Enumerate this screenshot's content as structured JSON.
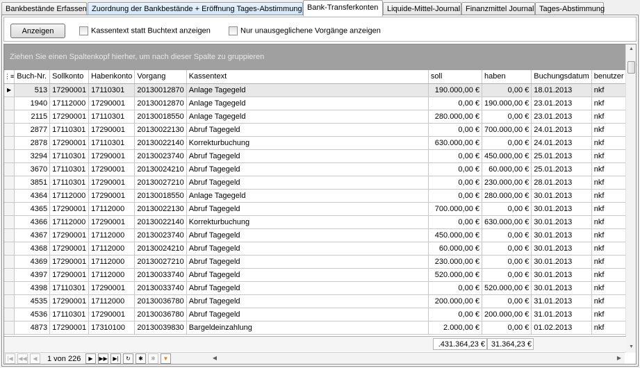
{
  "tabs": [
    {
      "label": "Bankbestände Erfassen",
      "state": "normal"
    },
    {
      "label": "Zuordnung der Bankbestände + Eröffnung Tages-Abstimmung",
      "state": "hover"
    },
    {
      "label": "Bank-Transferkonten",
      "state": "active"
    },
    {
      "label": "Liquide-Mittel-Journal",
      "state": "normal"
    },
    {
      "label": "Finanzmittel Journal",
      "state": "normal"
    },
    {
      "label": "Tages-Abstimmung",
      "state": "normal"
    }
  ],
  "toolbar": {
    "show_button": "Anzeigen",
    "checkbox_kassentext": "Kassentext statt Buchtext anzeigen",
    "checkbox_unbalanced": "Nur unausgeglichene Vorgänge anzeigen"
  },
  "grid": {
    "group_hint": "Ziehen Sie einen Spaltenkopf hierher, um nach dieser Spalte zu gruppieren",
    "columns": [
      "Buch-Nr.",
      "Sollkonto",
      "Habenkonto",
      "Vorgang",
      "Kassentext",
      "soll",
      "haben",
      "Buchungsdatum",
      "benutzer"
    ],
    "rows": [
      [
        "513",
        "17290001",
        "17110301",
        "20130012870",
        "Anlage Tagegeld",
        "190.000,00 €",
        "0,00 €",
        "18.01.2013",
        "nkf"
      ],
      [
        "1940",
        "17112000",
        "17290001",
        "20130012870",
        "Anlage Tagegeld",
        "0,00 €",
        "190.000,00 €",
        "23.01.2013",
        "nkf"
      ],
      [
        "2115",
        "17290001",
        "17110301",
        "20130018550",
        "Anlage Tagegeld",
        "280.000,00 €",
        "0,00 €",
        "23.01.2013",
        "nkf"
      ],
      [
        "2877",
        "17110301",
        "17290001",
        "20130022130",
        "Abruf Tagegeld",
        "0,00 €",
        "700.000,00 €",
        "24.01.2013",
        "nkf"
      ],
      [
        "2878",
        "17290001",
        "17110301",
        "20130022140",
        "Korrekturbuchung",
        "630.000,00 €",
        "0,00 €",
        "24.01.2013",
        "nkf"
      ],
      [
        "3294",
        "17110301",
        "17290001",
        "20130023740",
        "Abruf Tagegeld",
        "0,00 €",
        "450.000,00 €",
        "25.01.2013",
        "nkf"
      ],
      [
        "3670",
        "17110301",
        "17290001",
        "20130024210",
        "Abruf Tagegeld",
        "0,00 €",
        "60.000,00 €",
        "25.01.2013",
        "nkf"
      ],
      [
        "3851",
        "17110301",
        "17290001",
        "20130027210",
        "Abruf Tagegeld",
        "0,00 €",
        "230.000,00 €",
        "28.01.2013",
        "nkf"
      ],
      [
        "4364",
        "17112000",
        "17290001",
        "20130018550",
        "Anlage Tagegeld",
        "0,00 €",
        "280.000,00 €",
        "30.01.2013",
        "nkf"
      ],
      [
        "4365",
        "17290001",
        "17112000",
        "20130022130",
        "Abruf Tagegeld",
        "700.000,00 €",
        "0,00 €",
        "30.01.2013",
        "nkf"
      ],
      [
        "4366",
        "17112000",
        "17290001",
        "20130022140",
        "Korrekturbuchung",
        "0,00 €",
        "630.000,00 €",
        "30.01.2013",
        "nkf"
      ],
      [
        "4367",
        "17290001",
        "17112000",
        "20130023740",
        "Abruf Tagegeld",
        "450.000,00 €",
        "0,00 €",
        "30.01.2013",
        "nkf"
      ],
      [
        "4368",
        "17290001",
        "17112000",
        "20130024210",
        "Abruf Tagegeld",
        "60.000,00 €",
        "0,00 €",
        "30.01.2013",
        "nkf"
      ],
      [
        "4369",
        "17290001",
        "17112000",
        "20130027210",
        "Abruf Tagegeld",
        "230.000,00 €",
        "0,00 €",
        "30.01.2013",
        "nkf"
      ],
      [
        "4397",
        "17290001",
        "17112000",
        "20130033740",
        "Abruf Tagegeld",
        "520.000,00 €",
        "0,00 €",
        "30.01.2013",
        "nkf"
      ],
      [
        "4398",
        "17110301",
        "17290001",
        "20130033740",
        "Abruf Tagegeld",
        "0,00 €",
        "520.000,00 €",
        "30.01.2013",
        "nkf"
      ],
      [
        "4535",
        "17290001",
        "17112000",
        "20130036780",
        "Abruf Tagegeld",
        "200.000,00 €",
        "0,00 €",
        "31.01.2013",
        "nkf"
      ],
      [
        "4536",
        "17110301",
        "17290001",
        "20130036780",
        "Abruf Tagegeld",
        "0,00 €",
        "200.000,00 €",
        "31.01.2013",
        "nkf"
      ],
      [
        "4873",
        "17290001",
        "17310100",
        "20130039830",
        "Bargeldeinzahlung",
        "2.000,00 €",
        "0,00 €",
        "01.02.2013",
        "nkf"
      ]
    ],
    "sum_soll": ".431.364,23 €",
    "sum_haben": "31.364,23 €"
  },
  "navigator": {
    "page_info": "1 von 226"
  },
  "colors": {
    "group_panel": "#a0a0a0",
    "selected_row": "#e8e8e8",
    "filter_icon": "#e08000"
  }
}
